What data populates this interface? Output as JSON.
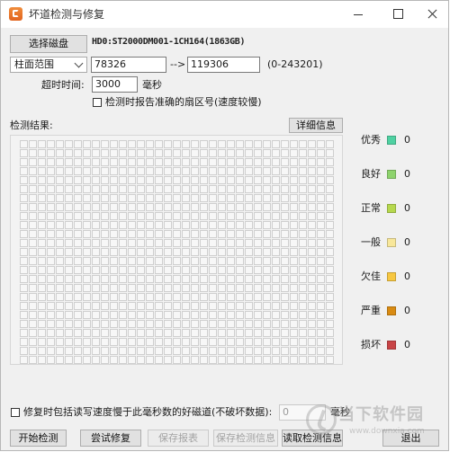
{
  "window": {
    "title": "坏道检测与修复"
  },
  "toolbar": {
    "select_disk_label": "选择磁盘",
    "disk_info": "HD0:ST2000DM001-1CH164(1863GB)",
    "range_mode": "柱面范围",
    "range_start": "78326",
    "range_arrow": "-->",
    "range_end": "119306",
    "range_hint": "(0-243201)",
    "timeout_label": "超时时间:",
    "timeout_value": "3000",
    "timeout_unit": "毫秒",
    "report_sector_label": "检测时报告准确的扇区号(速度较慢)"
  },
  "results": {
    "label": "检测结果:",
    "details_button": "详细信息",
    "cell_count": 875,
    "legend": [
      {
        "label": "优秀",
        "count": "0",
        "color": "#4fd1a2"
      },
      {
        "label": "良好",
        "count": "0",
        "color": "#8ed36d"
      },
      {
        "label": "正常",
        "count": "0",
        "color": "#b6d84e"
      },
      {
        "label": "一般",
        "count": "0",
        "color": "#f8e79a"
      },
      {
        "label": "欠佳",
        "count": "0",
        "color": "#f7c741"
      },
      {
        "label": "严重",
        "count": "0",
        "color": "#d98b12"
      },
      {
        "label": "损坏",
        "count": "0",
        "color": "#c84446"
      }
    ]
  },
  "repair_option": {
    "label": "修复时包括读写速度慢于此毫秒数的好磁道(不破坏数据):",
    "value": "0",
    "unit": "毫秒"
  },
  "actions": {
    "start": "开始检测",
    "try_repair": "尝试修复",
    "save_report": "保存报表",
    "save_info": "保存检测信息",
    "read_info": "读取检测信息",
    "exit": "退出"
  },
  "watermark": {
    "name": "当下软件园",
    "domain": "www.downxia.com"
  }
}
